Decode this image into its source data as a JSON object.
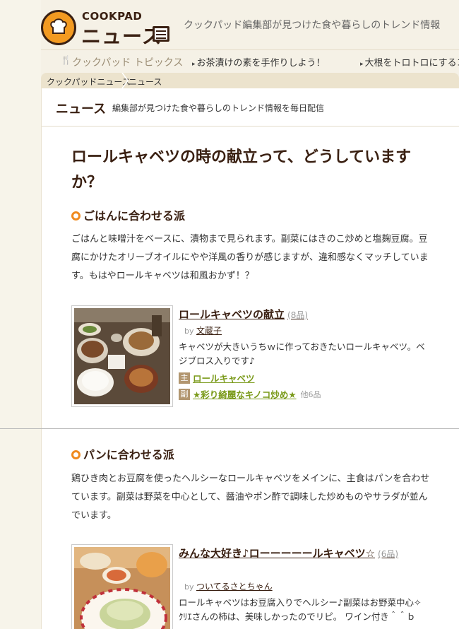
{
  "header": {
    "logo_top": "COOKPAD",
    "logo_main": "ニュース",
    "tagline": "クックパッド編集部が見つけた食や暮らしのトレンド情報"
  },
  "nav": {
    "topics_label": "クックパッド トピックス",
    "items": [
      {
        "label": "お茶漬けの素を手作りしよう！"
      },
      {
        "label": "大根をトロトロにするコツ"
      }
    ]
  },
  "breadcrumb": {
    "items": [
      {
        "label": "クックパッドニュース"
      },
      {
        "label": "ニュース"
      }
    ]
  },
  "news_header": {
    "title": "ニュース",
    "subtitle": "編集部が見つけた食や暮らしのトレンド情報を毎日配信"
  },
  "article": {
    "title": "ロールキャベツの時の献立って、どうしていますか？",
    "sections": [
      {
        "heading": "ごはんに合わせる派",
        "paragraph": "ごはんと味噌汁をベースに、漬物まで見られます。副菜にはきのこ炒めと塩麹豆腐。豆腐にかけたオリーブオイルにやや洋風の香りが感じますが、違和感なくマッチしています。もはやロールキャベツは和風おかず！？",
        "recipe": {
          "title": "ロールキャベツの献立",
          "count": "(8品)",
          "by_label": "by",
          "author": "文蔵子",
          "description": "キャベツが大きいうちｗに作っておきたいロールキャベツ。ベジブロス入りです♪",
          "main_badge": "主",
          "main_link": "ロールキャベツ",
          "side_badge": "副",
          "side_link": "★彩り綺麗なキノコ炒め★",
          "more": "他6品"
        }
      },
      {
        "heading": "パンに合わせる派",
        "paragraph": "鶏ひき肉とお豆腐を使ったヘルシーなロールキャベツをメインに、主食はパンを合わせています。副菜は野菜を中心として、醤油やポン酢で調味した炒めものやサラダが並んでいます。",
        "recipe": {
          "title": "みんな大好き♪ローーーーールキャベツ☆",
          "count": "(6品)",
          "by_label": "by",
          "author": "ついてるさとちゃん",
          "description": "ロールキャベツはお豆腐入りでヘルシー♪副菜はお野菜中心✧ ｸﾘｴさんの柿は、美味しかったのでリピ。 ワイン付き＾＾ｂ"
        }
      }
    ]
  },
  "colors": {
    "brand_brown": "#3a2012",
    "brand_orange": "#f39a21",
    "tag_green": "#7a9a1a",
    "badge_tan": "#b29670"
  }
}
